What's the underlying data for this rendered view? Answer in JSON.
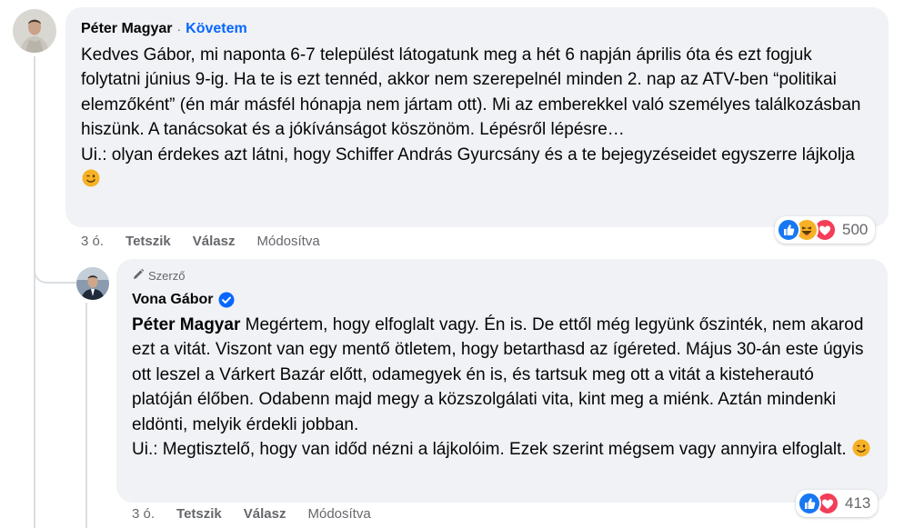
{
  "comment1": {
    "author": "Péter Magyar",
    "separator": "·",
    "follow_label": "Követem",
    "text": "Kedves Gábor, mi naponta 6-7 települést látogatunk meg a hét 6 napján április óta és ezt fogjuk folytatni június 9-ig. Ha te is ezt tennéd, akkor nem szerepelnél minden 2. nap az ATV-ben “politikai elemzőként” (én már másfél hónapja nem jártam ott). Mi az emberekkel való személyes találkozásban hiszünk. A tanácsokat és a jókívánságot köszönöm. Lépésről lépésre…\nUi.: olyan érdekes azt látni, hogy Schiffer András Gyurcsány és a te bejegyzéseidet egyszerre lájkolja",
    "time": "3 ó.",
    "like_label": "Tetszik",
    "reply_label": "Válasz",
    "edited_label": "Módosítva",
    "reaction_count": "500",
    "reaction_icons": [
      "like-icon",
      "haha-icon",
      "love-icon"
    ]
  },
  "comment2": {
    "badge": "Szerző",
    "author": "Vona Gábor",
    "mention": "Péter Magyar",
    "text": " Megértem, hogy elfoglalt vagy. Én is. De ettől még legyünk őszinték, nem akarod ezt a vitát. Viszont van egy mentő ötletem, hogy betarthasd az ígéreted. Május 30-án este úgyis ott leszel a Várkert Bazár előtt, odamegyek én is, és tartsuk meg ott a vitát a kisteherautó platóján élőben. Odabenn majd megy a közszolgálati vita, kint meg a miénk. Aztán mindenki eldönti, melyik érdekli jobban.\nUi.: Megtisztelő, hogy van időd nézni a lájkolóim. Ezek szerint mégsem vagy annyira elfoglalt. ",
    "time": "3 ó.",
    "like_label": "Tetszik",
    "reply_label": "Válasz",
    "edited_label": "Módosítva",
    "reaction_count": "413",
    "reaction_icons": [
      "like-icon",
      "love-icon"
    ]
  },
  "colors": {
    "bubble": "#f0f2f5",
    "link": "#0866ff",
    "muted": "#65676b",
    "like": "#1877f2",
    "love": "#f33e58",
    "haha": "#f7b125"
  }
}
